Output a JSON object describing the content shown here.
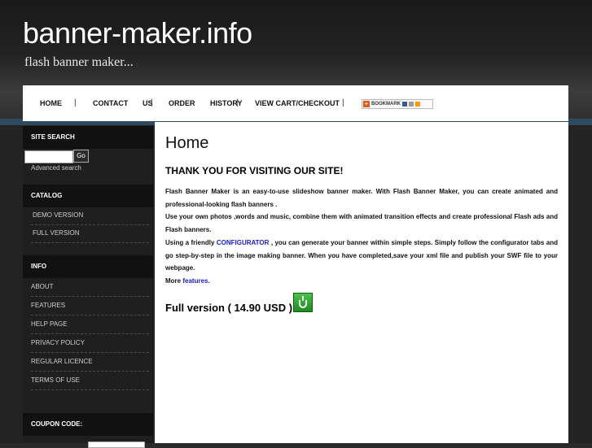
{
  "header": {
    "site_title": "banner-maker.info",
    "tagline": "flash banner maker..."
  },
  "nav": {
    "items": [
      "HOME",
      "CONTACT",
      "US",
      "ORDER",
      "HISTORY",
      "VIEW CART/CHECKOUT"
    ],
    "separator": "|",
    "bookmark_label": "BOOKMARK"
  },
  "sidebar": {
    "search": {
      "heading": "SITE SEARCH",
      "go_label": "Go",
      "advanced_link": "Advanced search",
      "value": ""
    },
    "catalog": {
      "heading": "CATALOG",
      "items": [
        "DEMO VERSION",
        "FULL VERSION"
      ]
    },
    "info": {
      "heading": "INFO",
      "items": [
        "ABOUT",
        "FEATURES",
        "HELP PAGE",
        "PRIVACY POLICY",
        "REGULAR LICENCE",
        "TERMS OF USE"
      ]
    },
    "coupon": {
      "heading": "COUPON CODE:"
    }
  },
  "main": {
    "title": "Home",
    "heading": "THANK YOU FOR VISITING OUR SITE!",
    "paragraph1": "Flash Banner Maker is an easy-to-use slideshow banner maker. With Flash Banner Maker, you can create animated and professional-looking flash banners .",
    "paragraph2": "Use your own photos ,words and music, combine them with animated transition effects and create professional Flash ads and Flash banners.",
    "paragraph3_before": "Using a friendly ",
    "paragraph3_link": "CONFIGURATOR",
    "paragraph3_after": " , you can generate your banner within simple steps. Simply follow the configurator tabs and go step-by-step in the image making banner. When you have completed,save your xml file and publish your SWF file to your webpage.",
    "more_before": "More ",
    "more_link": "features.",
    "price_text": "Full version ( 14.90 USD ) :"
  },
  "colors": {
    "accent_stripe": "#2e4a60",
    "link": "#1a1acc",
    "cart_icon": "#2aa02a"
  }
}
